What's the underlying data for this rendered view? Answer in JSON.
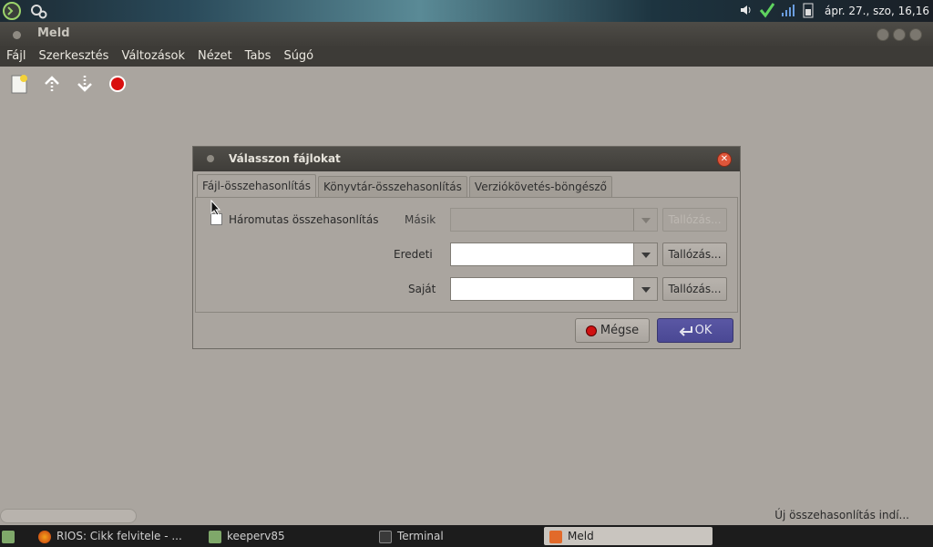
{
  "top_panel": {
    "clock": "ápr. 27., szo, 16,16"
  },
  "window": {
    "title": "Meld"
  },
  "menubar": {
    "items": [
      "Fájl",
      "Szerkesztés",
      "Változások",
      "Nézet",
      "Tabs",
      "Súgó"
    ]
  },
  "dialog": {
    "title": "Válasszon fájlokat",
    "tabs": [
      "Fájl-összehasonlítás",
      "Könyvtár-összehasonlítás",
      "Verziókövetés-böngésző"
    ],
    "three_way_label": "Háromutas összehasonlítás",
    "rows": [
      {
        "label": "Másik",
        "browse": "Tallózás...",
        "disabled": true,
        "value": ""
      },
      {
        "label": "Eredeti",
        "browse": "Tallózás...",
        "disabled": false,
        "value": ""
      },
      {
        "label": "Saját",
        "browse": "Tallózás...",
        "disabled": false,
        "value": ""
      }
    ],
    "cancel_label": "Mégse",
    "ok_label": "OK"
  },
  "statusbar": {
    "text": "Új összehasonlítás indí..."
  },
  "taskbar": {
    "tasks": [
      {
        "label": "RIOS: Cikk felvitele - ..."
      },
      {
        "label": "keeperv85"
      },
      {
        "label": "Terminal"
      },
      {
        "label": "Meld"
      }
    ]
  }
}
